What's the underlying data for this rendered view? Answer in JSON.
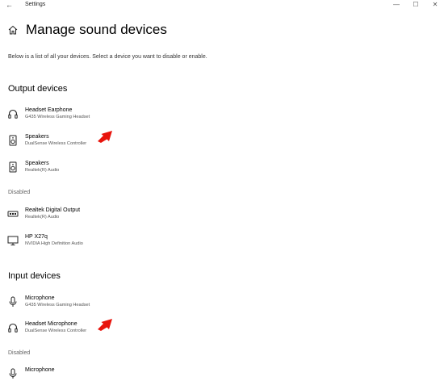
{
  "window": {
    "title": "Settings",
    "back_glyph": "←",
    "minimize_glyph": "—",
    "maximize_glyph": "☐",
    "close_glyph": "✕"
  },
  "page": {
    "title": "Manage sound devices",
    "description": "Below is a list of all your devices. Select a device you want to disable or enable."
  },
  "output": {
    "heading": "Output devices",
    "active": [
      {
        "name": "Headset Earphone",
        "sub": "G435 Wireless Gaming Headset",
        "icon": "headset-icon"
      },
      {
        "name": "Speakers",
        "sub": "DualSense Wireless Controller",
        "icon": "speaker-icon"
      },
      {
        "name": "Speakers",
        "sub": "Realtek(R) Audio",
        "icon": "speaker-icon"
      }
    ],
    "disabled_label": "Disabled",
    "disabled": [
      {
        "name": "Realtek Digital Output",
        "sub": "Realtek(R) Audio",
        "icon": "digital-output-icon"
      },
      {
        "name": "HP X27q",
        "sub": "NVIDIA High Definition Audio",
        "icon": "monitor-icon"
      }
    ]
  },
  "input": {
    "heading": "Input devices",
    "active": [
      {
        "name": "Microphone",
        "sub": "G435 Wireless Gaming Headset",
        "icon": "microphone-icon"
      },
      {
        "name": "Headset Microphone",
        "sub": "DualSense Wireless Controller",
        "icon": "headset-icon"
      }
    ],
    "disabled_label": "Disabled",
    "disabled": [
      {
        "name": "Microphone",
        "sub": "",
        "icon": "microphone-icon"
      }
    ]
  },
  "annotations": {
    "arrow_color": "#e8140c"
  }
}
